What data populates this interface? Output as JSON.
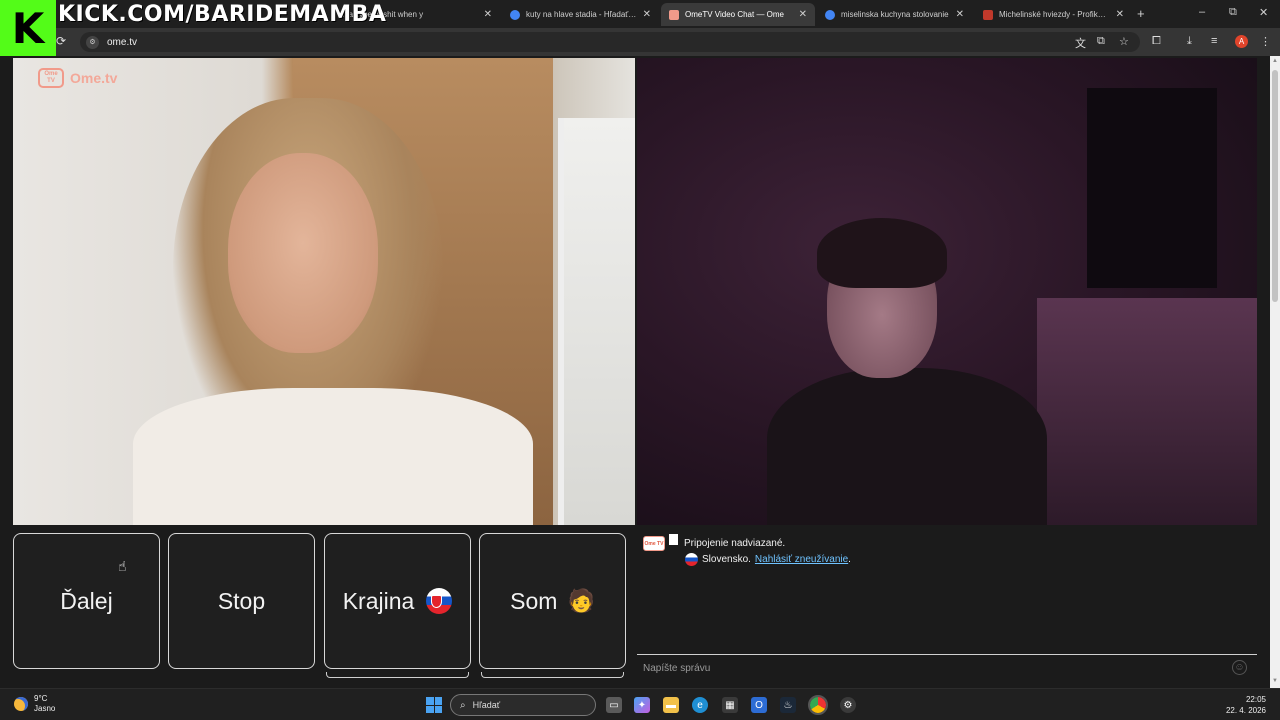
{
  "browser": {
    "tabs": [
      {
        "label": "ania 'type of shit when y",
        "active": false,
        "favicon_color": "#e8e8e8"
      },
      {
        "label": "kuty na hlave stadia - Hľadať G",
        "active": false,
        "favicon_color": "#4285f4"
      },
      {
        "label": "OmeTV Video Chat — Ome",
        "active": true,
        "favicon_color": "#f19a8a"
      },
      {
        "label": "miselinska kuchyna stolovanie",
        "active": false,
        "favicon_color": "#4285f4"
      },
      {
        "label": "Michelinské hviezdy - Profikuch",
        "active": false,
        "favicon_color": "#c0392b"
      }
    ],
    "new_tab": "+",
    "window_controls": {
      "minimize": "–",
      "restore": "⧉",
      "close": "✕"
    },
    "reload_icon": "⟳",
    "address": "ome.tv",
    "profile_initial": "A"
  },
  "overlay": {
    "kick_letter": "K",
    "kick_url": "KICK.COM/BARIDEMAMBA"
  },
  "page": {
    "logo_word": "Ome.tv",
    "logo_badge": "Ome TV",
    "controls": {
      "next_label": "Ďalej",
      "stop_label": "Stop",
      "country_label": "Krajina",
      "gender_label": "Som",
      "gender_emoji": "🧑"
    },
    "chat": {
      "logo_small": "Ome TV",
      "connected_text": "Pripojenie nadviazané.",
      "country_text": "Slovensko.",
      "report_link": "Nahlásiť zneužívanie",
      "report_suffix": ".",
      "input_placeholder": "Napíšte správu",
      "smiley_icon": "☺"
    }
  },
  "taskbar": {
    "weather_temp": "9°C",
    "weather_desc": "Jasno",
    "search_placeholder": "Hľadať",
    "time": "22:05",
    "date": "22. 4. 2026"
  }
}
